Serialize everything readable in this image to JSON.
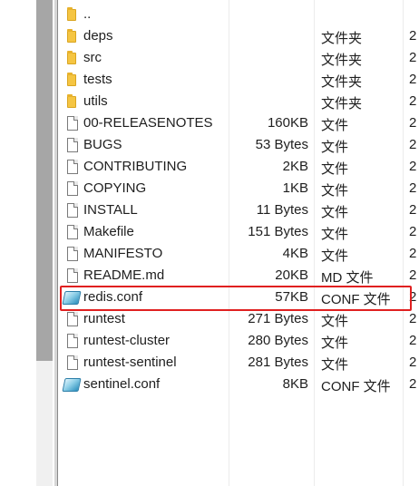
{
  "files": [
    {
      "name": "..",
      "size": "",
      "type": "",
      "trunc": "",
      "icon": "folder-icon"
    },
    {
      "name": "deps",
      "size": "",
      "type": "文件夹",
      "trunc": "2",
      "icon": "folder-icon"
    },
    {
      "name": "src",
      "size": "",
      "type": "文件夹",
      "trunc": "2",
      "icon": "folder-icon"
    },
    {
      "name": "tests",
      "size": "",
      "type": "文件夹",
      "trunc": "2",
      "icon": "folder-icon"
    },
    {
      "name": "utils",
      "size": "",
      "type": "文件夹",
      "trunc": "2",
      "icon": "folder-icon"
    },
    {
      "name": "00-RELEASENOTES",
      "size": "160KB",
      "type": "文件",
      "trunc": "2",
      "icon": "doc-icon"
    },
    {
      "name": "BUGS",
      "size": "53 Bytes",
      "type": "文件",
      "trunc": "2",
      "icon": "doc-icon"
    },
    {
      "name": "CONTRIBUTING",
      "size": "2KB",
      "type": "文件",
      "trunc": "2",
      "icon": "doc-icon"
    },
    {
      "name": "COPYING",
      "size": "1KB",
      "type": "文件",
      "trunc": "2",
      "icon": "doc-icon"
    },
    {
      "name": "INSTALL",
      "size": "11 Bytes",
      "type": "文件",
      "trunc": "2",
      "icon": "doc-icon"
    },
    {
      "name": "Makefile",
      "size": "151 Bytes",
      "type": "文件",
      "trunc": "2",
      "icon": "doc-icon"
    },
    {
      "name": "MANIFESTO",
      "size": "4KB",
      "type": "文件",
      "trunc": "2",
      "icon": "doc-icon"
    },
    {
      "name": "README.md",
      "size": "20KB",
      "type": "MD 文件",
      "trunc": "2",
      "icon": "doc-icon"
    },
    {
      "name": "redis.conf",
      "size": "57KB",
      "type": "CONF 文件",
      "trunc": "2",
      "icon": "conf-icon"
    },
    {
      "name": "runtest",
      "size": "271 Bytes",
      "type": "文件",
      "trunc": "2",
      "icon": "doc-icon"
    },
    {
      "name": "runtest-cluster",
      "size": "280 Bytes",
      "type": "文件",
      "trunc": "2",
      "icon": "doc-icon"
    },
    {
      "name": "runtest-sentinel",
      "size": "281 Bytes",
      "type": "文件",
      "trunc": "2",
      "icon": "doc-icon"
    },
    {
      "name": "sentinel.conf",
      "size": "8KB",
      "type": "CONF 文件",
      "trunc": "2",
      "icon": "conf-icon"
    }
  ],
  "highlight": {
    "row_index": 13,
    "color": "#e02020"
  },
  "colors": {
    "folder": "#f5c542",
    "text": "#1e1e1e",
    "scrollbar_thumb": "#a6a6a6"
  }
}
